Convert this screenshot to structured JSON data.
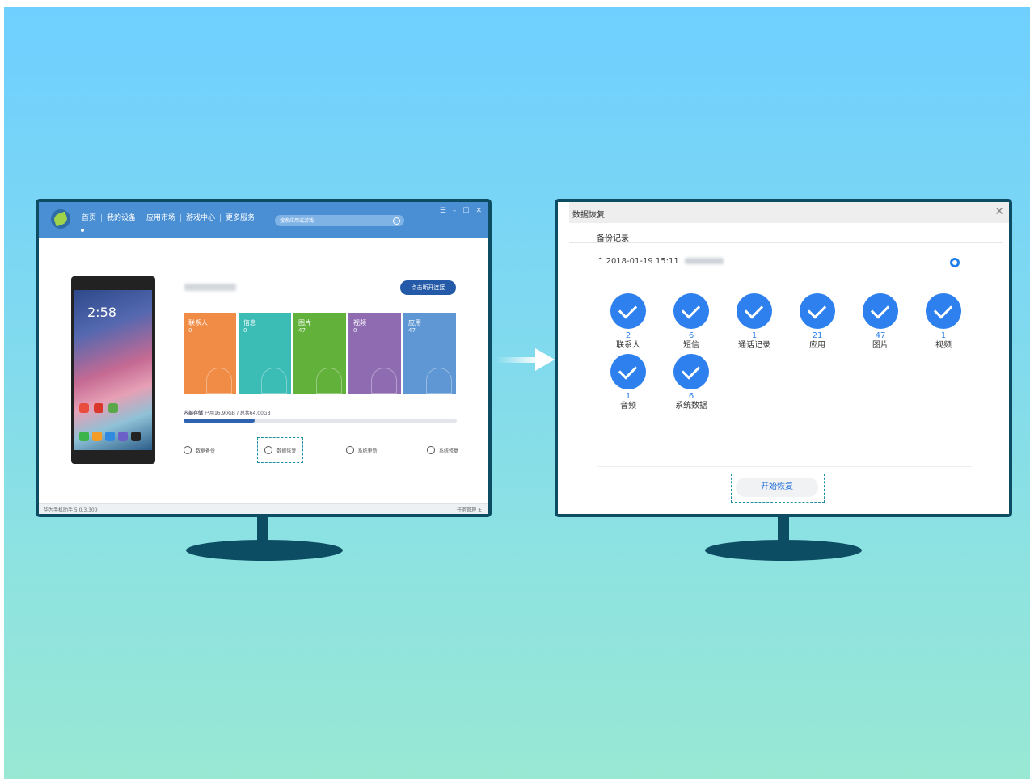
{
  "left_app": {
    "nav": [
      "首页",
      "我的设备",
      "应用市场",
      "游戏中心",
      "更多服务"
    ],
    "search_placeholder": "搜索应用或游戏",
    "phone_time": "2:58",
    "disconnect_label": "点击断开连接",
    "tiles": [
      {
        "label": "联系人",
        "count": "0",
        "color": "#f08c46"
      },
      {
        "label": "信息",
        "count": "0",
        "color": "#3bbcb5"
      },
      {
        "label": "图片",
        "count": "47",
        "color": "#62b13a"
      },
      {
        "label": "视频",
        "count": "0",
        "color": "#8f6cb2"
      },
      {
        "label": "应用",
        "count": "47",
        "color": "#5f97d4"
      }
    ],
    "storage": {
      "label": "内部存储",
      "detail": "已用16.90GB / 总共64.00GB",
      "used_fraction": 0.26
    },
    "actions": [
      "数据备份",
      "数据恢复",
      "系统更新",
      "系统修复"
    ],
    "status_left": "华为手机助手 5.0.3.300",
    "status_right": "任务管理 ±"
  },
  "right_dialog": {
    "title": "数据恢复",
    "backup_records_label": "备份记录",
    "record_time": "2018-01-19 15:11",
    "items": [
      {
        "count": "2",
        "label": "联系人"
      },
      {
        "count": "6",
        "label": "短信"
      },
      {
        "count": "1",
        "label": "通话记录"
      },
      {
        "count": "21",
        "label": "应用"
      },
      {
        "count": "47",
        "label": "图片"
      },
      {
        "count": "1",
        "label": "视频"
      },
      {
        "count": "1",
        "label": "音频"
      },
      {
        "count": "6",
        "label": "系统数据"
      }
    ],
    "start_button": "开始恢复"
  }
}
